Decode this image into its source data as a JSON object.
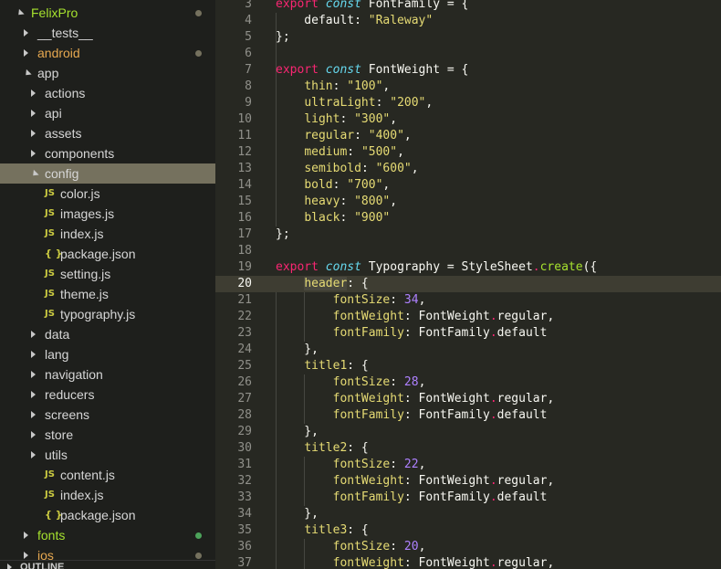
{
  "colors": {
    "editor_bg": "#272822",
    "sidebar_bg": "#1e1f1c",
    "selection_bg": "#75715e",
    "keyword": "#f92672",
    "storage": "#66d9ef",
    "string": "#e6db74",
    "number": "#ae81ff",
    "function": "#a6e22e",
    "dot_modified": "#75715e",
    "dot_added": "#4ca35a"
  },
  "explorer": {
    "outline_title": "OUTLINE",
    "items": [
      {
        "label": "FelixPro",
        "depth": 0,
        "kind": "folder-open",
        "color": "green",
        "dot": "modified"
      },
      {
        "label": "__tests__",
        "depth": 1,
        "kind": "folder"
      },
      {
        "label": "android",
        "depth": 1,
        "kind": "folder",
        "color": "orange",
        "dot": "modified"
      },
      {
        "label": "app",
        "depth": 1,
        "kind": "folder-open"
      },
      {
        "label": "actions",
        "depth": 2,
        "kind": "folder"
      },
      {
        "label": "api",
        "depth": 2,
        "kind": "folder"
      },
      {
        "label": "assets",
        "depth": 2,
        "kind": "folder"
      },
      {
        "label": "components",
        "depth": 2,
        "kind": "folder"
      },
      {
        "label": "config",
        "depth": 2,
        "kind": "folder-open",
        "selected": true
      },
      {
        "label": "color.js",
        "depth": 3,
        "kind": "js"
      },
      {
        "label": "images.js",
        "depth": 3,
        "kind": "js"
      },
      {
        "label": "index.js",
        "depth": 3,
        "kind": "js"
      },
      {
        "label": "package.json",
        "depth": 3,
        "kind": "json"
      },
      {
        "label": "setting.js",
        "depth": 3,
        "kind": "js"
      },
      {
        "label": "theme.js",
        "depth": 3,
        "kind": "js"
      },
      {
        "label": "typography.js",
        "depth": 3,
        "kind": "js"
      },
      {
        "label": "data",
        "depth": 2,
        "kind": "folder"
      },
      {
        "label": "lang",
        "depth": 2,
        "kind": "folder"
      },
      {
        "label": "navigation",
        "depth": 2,
        "kind": "folder"
      },
      {
        "label": "reducers",
        "depth": 2,
        "kind": "folder"
      },
      {
        "label": "screens",
        "depth": 2,
        "kind": "folder"
      },
      {
        "label": "store",
        "depth": 2,
        "kind": "folder"
      },
      {
        "label": "utils",
        "depth": 2,
        "kind": "folder"
      },
      {
        "label": "content.js",
        "depth": 2,
        "kind": "js"
      },
      {
        "label": "index.js",
        "depth": 2,
        "kind": "js"
      },
      {
        "label": "package.json",
        "depth": 2,
        "kind": "json"
      },
      {
        "label": "fonts",
        "depth": 1,
        "kind": "folder",
        "color": "green",
        "dot": "added"
      },
      {
        "label": "ios",
        "depth": 1,
        "kind": "folder",
        "color": "orange",
        "dot": "modified"
      }
    ]
  },
  "editor": {
    "current_line": 20,
    "lines": [
      {
        "n": "3",
        "tokens": [
          [
            "kw",
            "export"
          ],
          [
            "p",
            " "
          ],
          [
            "st",
            "const"
          ],
          [
            "p",
            " FontFamily = {"
          ]
        ]
      },
      {
        "n": "4",
        "tokens": [
          [
            "p",
            "    default: "
          ],
          [
            "s",
            "\"Raleway\""
          ]
        ]
      },
      {
        "n": "5",
        "tokens": [
          [
            "p",
            "};"
          ]
        ]
      },
      {
        "n": "6",
        "tokens": []
      },
      {
        "n": "7",
        "tokens": [
          [
            "kw",
            "export"
          ],
          [
            "p",
            " "
          ],
          [
            "st",
            "const"
          ],
          [
            "p",
            " FontWeight = {"
          ]
        ]
      },
      {
        "n": "8",
        "tokens": [
          [
            "p",
            "    "
          ],
          [
            "pr",
            "thin"
          ],
          [
            "p",
            ": "
          ],
          [
            "s",
            "\"100\""
          ],
          [
            "p",
            ","
          ]
        ]
      },
      {
        "n": "9",
        "tokens": [
          [
            "p",
            "    "
          ],
          [
            "pr",
            "ultraLight"
          ],
          [
            "p",
            ": "
          ],
          [
            "s",
            "\"200\""
          ],
          [
            "p",
            ","
          ]
        ]
      },
      {
        "n": "10",
        "tokens": [
          [
            "p",
            "    "
          ],
          [
            "pr",
            "light"
          ],
          [
            "p",
            ": "
          ],
          [
            "s",
            "\"300\""
          ],
          [
            "p",
            ","
          ]
        ]
      },
      {
        "n": "11",
        "tokens": [
          [
            "p",
            "    "
          ],
          [
            "pr",
            "regular"
          ],
          [
            "p",
            ": "
          ],
          [
            "s",
            "\"400\""
          ],
          [
            "p",
            ","
          ]
        ]
      },
      {
        "n": "12",
        "tokens": [
          [
            "p",
            "    "
          ],
          [
            "pr",
            "medium"
          ],
          [
            "p",
            ": "
          ],
          [
            "s",
            "\"500\""
          ],
          [
            "p",
            ","
          ]
        ]
      },
      {
        "n": "13",
        "tokens": [
          [
            "p",
            "    "
          ],
          [
            "pr",
            "semibold"
          ],
          [
            "p",
            ": "
          ],
          [
            "s",
            "\"600\""
          ],
          [
            "p",
            ","
          ]
        ]
      },
      {
        "n": "14",
        "tokens": [
          [
            "p",
            "    "
          ],
          [
            "pr",
            "bold"
          ],
          [
            "p",
            ": "
          ],
          [
            "s",
            "\"700\""
          ],
          [
            "p",
            ","
          ]
        ]
      },
      {
        "n": "15",
        "tokens": [
          [
            "p",
            "    "
          ],
          [
            "pr",
            "heavy"
          ],
          [
            "p",
            ": "
          ],
          [
            "s",
            "\"800\""
          ],
          [
            "p",
            ","
          ]
        ]
      },
      {
        "n": "16",
        "tokens": [
          [
            "p",
            "    "
          ],
          [
            "pr",
            "black"
          ],
          [
            "p",
            ": "
          ],
          [
            "s",
            "\"900\""
          ]
        ]
      },
      {
        "n": "17",
        "tokens": [
          [
            "p",
            "};"
          ]
        ]
      },
      {
        "n": "18",
        "tokens": []
      },
      {
        "n": "19",
        "tokens": [
          [
            "kw",
            "export"
          ],
          [
            "p",
            " "
          ],
          [
            "st",
            "const"
          ],
          [
            "p",
            " Typography = StyleSheet"
          ],
          [
            "dot",
            "."
          ],
          [
            "fn",
            "create"
          ],
          [
            "p",
            "({"
          ]
        ]
      },
      {
        "n": "20",
        "tokens": [
          [
            "p",
            "    "
          ],
          [
            "hl",
            "header"
          ],
          [
            "p",
            ": {"
          ]
        ]
      },
      {
        "n": "21",
        "tokens": [
          [
            "p",
            "        "
          ],
          [
            "pr",
            "fontSize"
          ],
          [
            "p",
            ": "
          ],
          [
            "num",
            "34"
          ],
          [
            "p",
            ","
          ]
        ]
      },
      {
        "n": "22",
        "tokens": [
          [
            "p",
            "        "
          ],
          [
            "pr",
            "fontWeight"
          ],
          [
            "p",
            ": FontWeight"
          ],
          [
            "dot",
            "."
          ],
          [
            "p",
            "regular,"
          ]
        ]
      },
      {
        "n": "23",
        "tokens": [
          [
            "p",
            "        "
          ],
          [
            "pr",
            "fontFamily"
          ],
          [
            "p",
            ": FontFamily"
          ],
          [
            "dot",
            "."
          ],
          [
            "p",
            "default"
          ]
        ]
      },
      {
        "n": "24",
        "tokens": [
          [
            "p",
            "    },"
          ]
        ]
      },
      {
        "n": "25",
        "tokens": [
          [
            "p",
            "    "
          ],
          [
            "pr",
            "title1"
          ],
          [
            "p",
            ": {"
          ]
        ]
      },
      {
        "n": "26",
        "tokens": [
          [
            "p",
            "        "
          ],
          [
            "pr",
            "fontSize"
          ],
          [
            "p",
            ": "
          ],
          [
            "num",
            "28"
          ],
          [
            "p",
            ","
          ]
        ]
      },
      {
        "n": "27",
        "tokens": [
          [
            "p",
            "        "
          ],
          [
            "pr",
            "fontWeight"
          ],
          [
            "p",
            ": FontWeight"
          ],
          [
            "dot",
            "."
          ],
          [
            "p",
            "regular,"
          ]
        ]
      },
      {
        "n": "28",
        "tokens": [
          [
            "p",
            "        "
          ],
          [
            "pr",
            "fontFamily"
          ],
          [
            "p",
            ": FontFamily"
          ],
          [
            "dot",
            "."
          ],
          [
            "p",
            "default"
          ]
        ]
      },
      {
        "n": "29",
        "tokens": [
          [
            "p",
            "    },"
          ]
        ]
      },
      {
        "n": "30",
        "tokens": [
          [
            "p",
            "    "
          ],
          [
            "pr",
            "title2"
          ],
          [
            "p",
            ": {"
          ]
        ]
      },
      {
        "n": "31",
        "tokens": [
          [
            "p",
            "        "
          ],
          [
            "pr",
            "fontSize"
          ],
          [
            "p",
            ": "
          ],
          [
            "num",
            "22"
          ],
          [
            "p",
            ","
          ]
        ]
      },
      {
        "n": "32",
        "tokens": [
          [
            "p",
            "        "
          ],
          [
            "pr",
            "fontWeight"
          ],
          [
            "p",
            ": FontWeight"
          ],
          [
            "dot",
            "."
          ],
          [
            "p",
            "regular,"
          ]
        ]
      },
      {
        "n": "33",
        "tokens": [
          [
            "p",
            "        "
          ],
          [
            "pr",
            "fontFamily"
          ],
          [
            "p",
            ": FontFamily"
          ],
          [
            "dot",
            "."
          ],
          [
            "p",
            "default"
          ]
        ]
      },
      {
        "n": "34",
        "tokens": [
          [
            "p",
            "    },"
          ]
        ]
      },
      {
        "n": "35",
        "tokens": [
          [
            "p",
            "    "
          ],
          [
            "pr",
            "title3"
          ],
          [
            "p",
            ": {"
          ]
        ]
      },
      {
        "n": "36",
        "tokens": [
          [
            "p",
            "        "
          ],
          [
            "pr",
            "fontSize"
          ],
          [
            "p",
            ": "
          ],
          [
            "num",
            "20"
          ],
          [
            "p",
            ","
          ]
        ]
      },
      {
        "n": "37",
        "tokens": [
          [
            "p",
            "        "
          ],
          [
            "pr",
            "fontWeight"
          ],
          [
            "p",
            ": FontWeight"
          ],
          [
            "dot",
            "."
          ],
          [
            "p",
            "regular,"
          ]
        ]
      }
    ]
  }
}
